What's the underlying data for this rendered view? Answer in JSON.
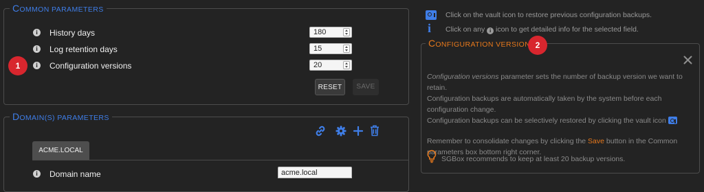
{
  "common": {
    "legend_first": "C",
    "legend_rest": "OMMON PARAMETERS",
    "rows": [
      {
        "label": "History days",
        "value": "180"
      },
      {
        "label": "Log retention days",
        "value": "15"
      },
      {
        "label": "Configuration versions",
        "value": "20"
      }
    ],
    "reset_label": "RESET",
    "save_label": "SAVE"
  },
  "domain": {
    "legend_first": "D",
    "legend_rest": "OMAIN(S) PARAMETERS",
    "tab_label": "ACME.LOCAL",
    "field_label": "Domain name",
    "field_value": "acme.local"
  },
  "badges": {
    "one": "1",
    "two": "2"
  },
  "tips": {
    "vault_tip": "Click on the vault icon to restore previous configuration backups.",
    "info_tip_before": "Click on any",
    "info_tip_after": "icon to get detailed info for the selected field."
  },
  "help": {
    "legend_first": "C",
    "legend_rest": "ONFIGURATION VERSIONS",
    "line1_italic": "Configuration versions",
    "line1_rest": " parameter sets the number of backup version we want to retain.",
    "line2": "Configuration backups are automatically taken by the system before each configuration change.",
    "line3": "Configuration backups can be selectively restored by clicking the vault icon",
    "line4_before": "Remember to consolidate changes by clicking the ",
    "line4_save": "Save",
    "line4_after": " button in the Common parameters box bottom right corner.",
    "recommend": "SGBox recommends to keep at least 20 backup versions."
  },
  "colors": {
    "accent_blue": "#3f7ee8",
    "accent_orange": "#e8791c",
    "badge_red": "#d8262e"
  }
}
